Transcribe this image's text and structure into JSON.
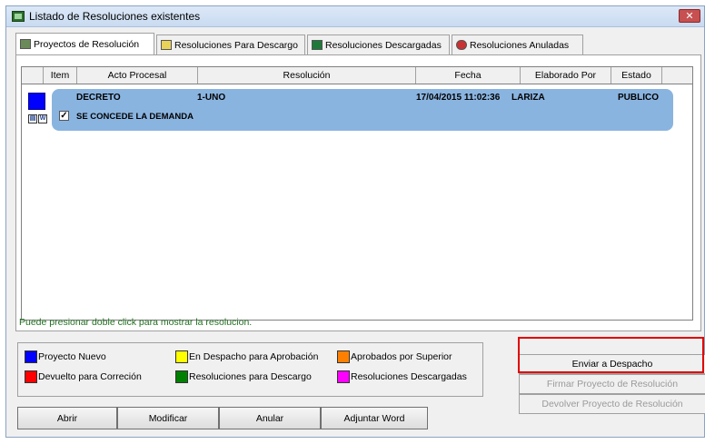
{
  "window": {
    "title": "Listado de Resoluciones existentes",
    "close_label": "✕"
  },
  "tabs": [
    {
      "label": "Proyectos de Resolución",
      "active": true
    },
    {
      "label": "Resoluciones Para Descargo",
      "active": false
    },
    {
      "label": "Resoluciones Descargadas",
      "active": false
    },
    {
      "label": "Resoluciones Anuladas",
      "active": false
    }
  ],
  "grid": {
    "columns": [
      "Item",
      "Acto Procesal",
      "Resolución",
      "Fecha",
      "Elaborado Por",
      "Estado"
    ],
    "rows": [
      {
        "acto": "DECRETO",
        "resolucion": "1-UNO",
        "fecha": "17/04/2015 11:02:36",
        "elaborado": "LARIZA",
        "estado": "PUBLICO",
        "detalle": "SE CONCEDE LA DEMANDA",
        "checked": true,
        "status_color": "#0000ff"
      }
    ]
  },
  "hint": "Puede presionar doble click para mostrar la resolucion.",
  "legend": [
    {
      "label": "Proyecto Nuevo",
      "color": "#0000ff"
    },
    {
      "label": "En Despacho para Aprobación",
      "color": "#ffff00"
    },
    {
      "label": "Aprobados por Superior",
      "color": "#ff8000"
    },
    {
      "label": "Devuelto para Correción",
      "color": "#ff0000"
    },
    {
      "label": "Resoluciones para Descargo",
      "color": "#008000"
    },
    {
      "label": "Resoluciones Descargadas",
      "color": "#ff00ff"
    }
  ],
  "buttons": {
    "abrir": "Abrir",
    "modificar": "Modificar",
    "anular": "Anular",
    "adjuntar": "Adjuntar Word",
    "enviar": "Enviar a Despacho",
    "firmar": "Firmar Proyecto de Resolución",
    "devolver": "Devolver Proyecto de Resolución"
  }
}
